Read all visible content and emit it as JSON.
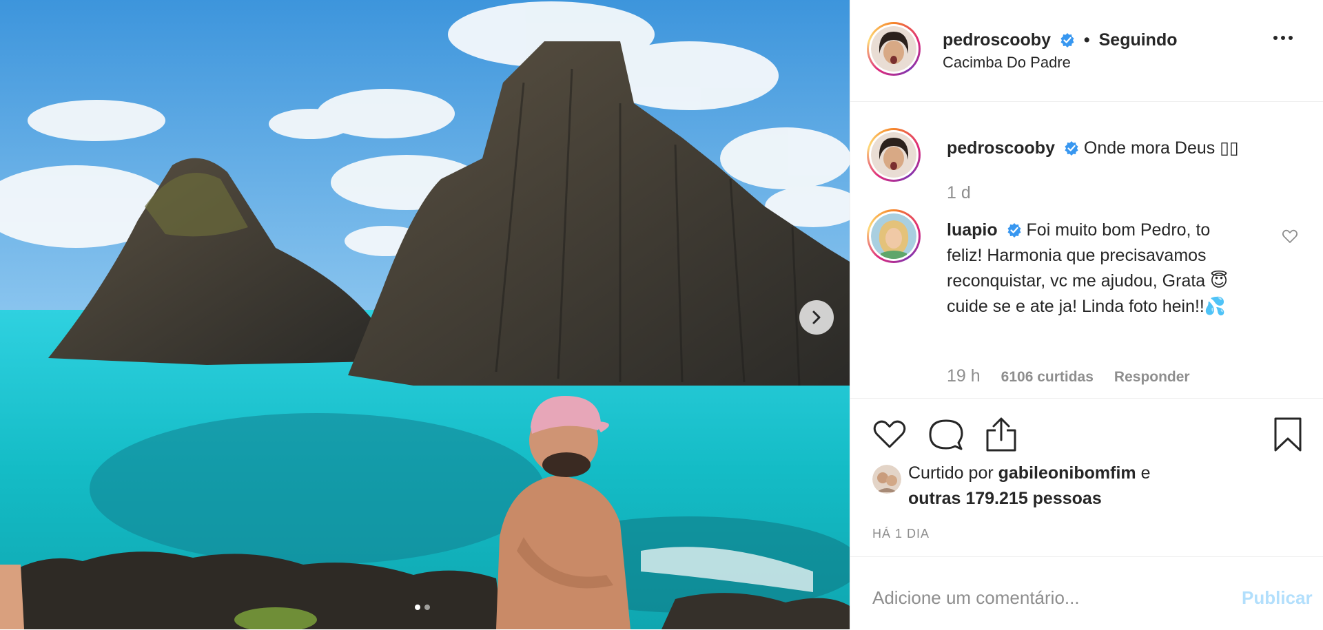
{
  "header": {
    "username": "pedroscooby",
    "separator": "•",
    "follow_status": "Seguindo",
    "location": "Cacimba Do Padre"
  },
  "caption": {
    "username": "pedroscooby",
    "text": "Onde mora Deus ▯▯",
    "time": "1 d"
  },
  "comment": {
    "username": "luapio",
    "text": "Foi muito bom Pedro, to feliz! Harmonia que precisavamos reconquistar, vc me ajudou, Grata 😇cuide se e ate ja! Linda foto hein!!💦",
    "time": "19 h",
    "likes": "6106 curtidas",
    "reply_label": "Responder"
  },
  "likes": {
    "prefix": "Curtido por",
    "user": "gabileonibomfim",
    "connector": "e",
    "others": "outras 179.215 pessoas"
  },
  "post_date": "HÁ 1 DIA",
  "add_comment": {
    "placeholder": "Adicione um comentário...",
    "publish_label": "Publicar"
  },
  "carousel": {
    "total": 2,
    "active_index": 0
  },
  "colors": {
    "verified_blue": "#3897f0",
    "publish_disabled": "#b2dffc",
    "sea": "#1fc6d4",
    "sky": "#4aa6e6"
  },
  "icons": [
    "heart-icon",
    "comment-icon",
    "share-icon",
    "bookmark-icon",
    "more-options-icon",
    "chevron-right-icon",
    "verified-badge-icon"
  ]
}
